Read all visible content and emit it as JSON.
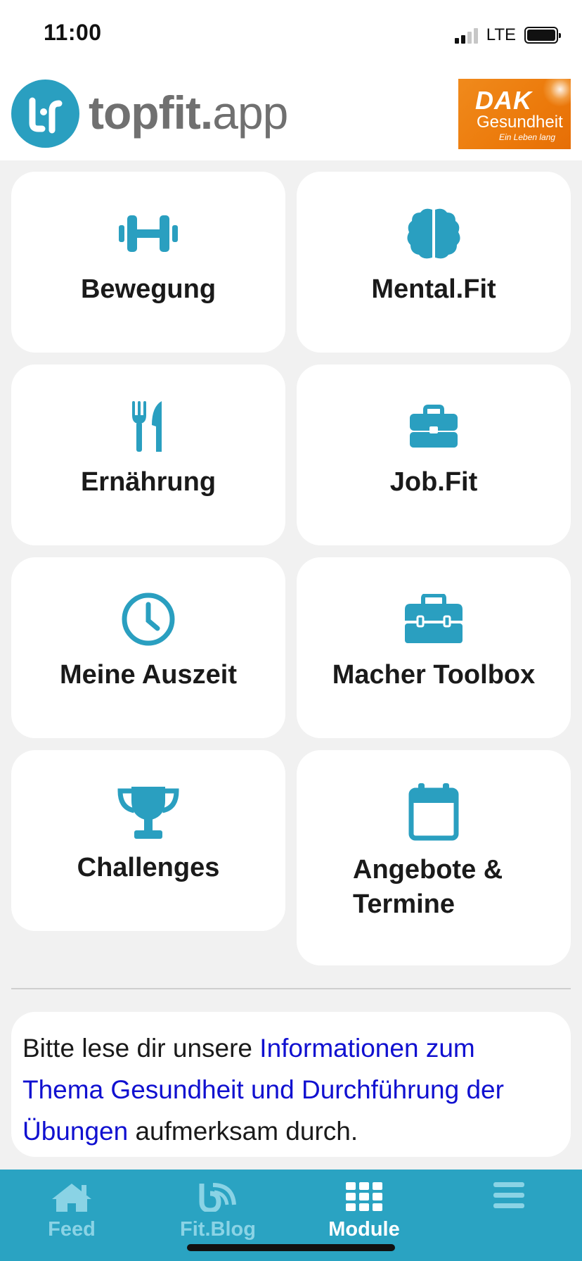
{
  "status_bar": {
    "time": "11:00",
    "network": "LTE",
    "icons": [
      "signal-icon",
      "battery-icon"
    ]
  },
  "header": {
    "logo_bold": "topfit.",
    "logo_light": "app",
    "partner_logo": {
      "line1": "DAK",
      "line2": "Gesundheit",
      "line3": "Ein Leben lang"
    }
  },
  "tiles": [
    {
      "label": "Bewegung",
      "icon": "dumbbell-icon"
    },
    {
      "label": "Mental.Fit",
      "icon": "brain-icon"
    },
    {
      "label": "Ernährung",
      "icon": "utensils-icon"
    },
    {
      "label": "Job.Fit",
      "icon": "briefcase-icon"
    },
    {
      "label": "Meine Auszeit",
      "icon": "clock-icon"
    },
    {
      "label": "Macher Toolbox",
      "icon": "toolbox-icon"
    },
    {
      "label": "Challenges",
      "icon": "trophy-icon"
    },
    {
      "label": "Angebote & Termine",
      "icon": "calendar-icon"
    }
  ],
  "info": {
    "prefix": "Bitte lese dir unsere ",
    "link": "Informationen zum Thema Gesundheit und Durchführung der Übungen",
    "suffix": " aufmerksam durch."
  },
  "tabbar": {
    "items": [
      {
        "label": "Feed",
        "icon": "home-icon",
        "active": false
      },
      {
        "label": "Fit.Blog",
        "icon": "blog-icon",
        "active": false
      },
      {
        "label": "Module",
        "icon": "grid-icon",
        "active": true
      },
      {
        "label": "",
        "icon": "menu-icon",
        "active": false
      }
    ]
  },
  "colors": {
    "accent": "#2aa3c2",
    "tile_icon": "#2a9fc0",
    "link": "#1010d0",
    "partner_orange": "#ec7a0b"
  }
}
